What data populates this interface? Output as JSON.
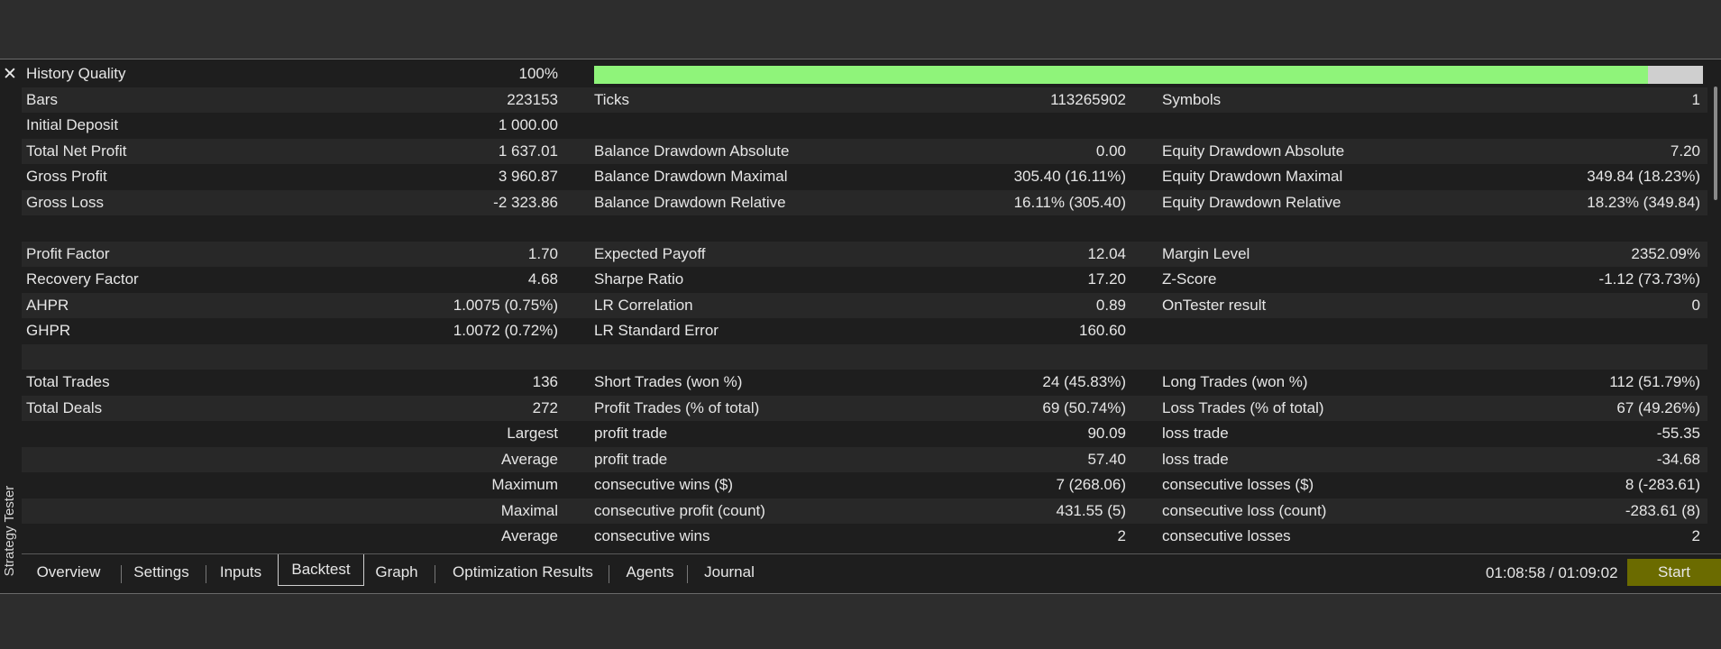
{
  "window": {
    "side_title": "Strategy Tester",
    "close_label": "✕"
  },
  "history_quality": {
    "label": "History Quality",
    "value": "100%",
    "fill_fraction": 0.95
  },
  "rows": [
    {
      "c1": "Bars",
      "v1": "223153",
      "c2": "Ticks",
      "v2": "113265902",
      "c3": "Symbols",
      "v3": "1"
    },
    {
      "c1": "Initial Deposit",
      "v1": "1 000.00",
      "c2": "",
      "v2": "",
      "c3": "",
      "v3": ""
    },
    {
      "c1": "Total Net Profit",
      "v1": "1 637.01",
      "c2": "Balance Drawdown Absolute",
      "v2": "0.00",
      "c3": "Equity Drawdown Absolute",
      "v3": "7.20"
    },
    {
      "c1": "Gross Profit",
      "v1": "3 960.87",
      "c2": "Balance Drawdown Maximal",
      "v2": "305.40 (16.11%)",
      "c3": "Equity Drawdown Maximal",
      "v3": "349.84 (18.23%)"
    },
    {
      "c1": "Gross Loss",
      "v1": "-2 323.86",
      "c2": "Balance Drawdown Relative",
      "v2": "16.11% (305.40)",
      "c3": "Equity Drawdown Relative",
      "v3": "18.23% (349.84)"
    },
    {
      "c1": "",
      "v1": "",
      "c2": "",
      "v2": "",
      "c3": "",
      "v3": ""
    },
    {
      "c1": "Profit Factor",
      "v1": "1.70",
      "c2": "Expected Payoff",
      "v2": "12.04",
      "c3": "Margin Level",
      "v3": "2352.09%"
    },
    {
      "c1": "Recovery Factor",
      "v1": "4.68",
      "c2": "Sharpe Ratio",
      "v2": "17.20",
      "c3": "Z-Score",
      "v3": "-1.12 (73.73%)"
    },
    {
      "c1": "AHPR",
      "v1": "1.0075 (0.75%)",
      "c2": "LR Correlation",
      "v2": "0.89",
      "c3": "OnTester result",
      "v3": "0"
    },
    {
      "c1": "GHPR",
      "v1": "1.0072 (0.72%)",
      "c2": "LR Standard Error",
      "v2": "160.60",
      "c3": "",
      "v3": ""
    },
    {
      "c1": "",
      "v1": "",
      "c2": "",
      "v2": "",
      "c3": "",
      "v3": ""
    },
    {
      "c1": "Total Trades",
      "v1": "136",
      "c2": "Short Trades (won %)",
      "v2": "24 (45.83%)",
      "c3": "Long Trades (won %)",
      "v3": "112 (51.79%)"
    },
    {
      "c1": "Total Deals",
      "v1": "272",
      "c2": "Profit Trades (% of total)",
      "v2": "69 (50.74%)",
      "c3": "Loss Trades (% of total)",
      "v3": "67 (49.26%)"
    },
    {
      "c1": "",
      "v1": "Largest",
      "c2": "profit trade",
      "v2": "90.09",
      "c3": "loss trade",
      "v3": "-55.35"
    },
    {
      "c1": "",
      "v1": "Average",
      "c2": "profit trade",
      "v2": "57.40",
      "c3": "loss trade",
      "v3": "-34.68"
    },
    {
      "c1": "",
      "v1": "Maximum",
      "c2": "consecutive wins ($)",
      "v2": "7 (268.06)",
      "c3": "consecutive losses ($)",
      "v3": "8 (-283.61)"
    },
    {
      "c1": "",
      "v1": "Maximal",
      "c2": "consecutive profit (count)",
      "v2": "431.55 (5)",
      "c3": "consecutive loss (count)",
      "v3": "-283.61 (8)"
    },
    {
      "c1": "",
      "v1": "Average",
      "c2": "consecutive wins",
      "v2": "2",
      "c3": "consecutive losses",
      "v3": "2"
    }
  ],
  "tabs": [
    "Overview",
    "Settings",
    "Inputs",
    "Backtest",
    "Graph",
    "Optimization Results",
    "Agents",
    "Journal"
  ],
  "active_tab": "Backtest",
  "timer": "01:08:58 / 01:09:02",
  "start_label": "Start",
  "colors": {
    "quality_fill": "#8ff47a",
    "start_button": "#6b6b00"
  }
}
